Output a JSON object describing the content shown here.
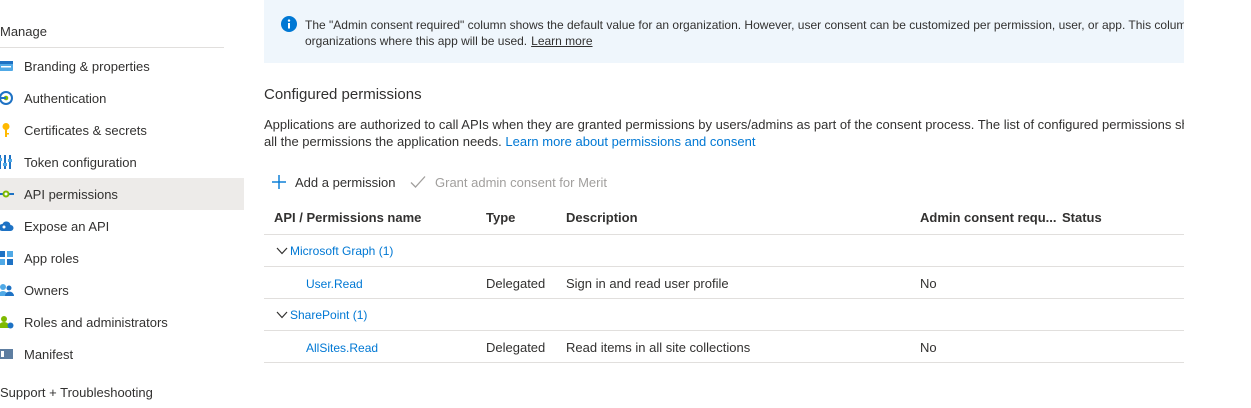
{
  "sidebar": {
    "manage_header": "Manage",
    "support_header": "Support + Troubleshooting",
    "items": [
      {
        "label": "Branding & properties",
        "icon": "branding-icon"
      },
      {
        "label": "Authentication",
        "icon": "authentication-icon"
      },
      {
        "label": "Certificates & secrets",
        "icon": "key-icon"
      },
      {
        "label": "Token configuration",
        "icon": "token-icon"
      },
      {
        "label": "API permissions",
        "icon": "api-permissions-icon",
        "active": true
      },
      {
        "label": "Expose an API",
        "icon": "cloud-icon"
      },
      {
        "label": "App roles",
        "icon": "app-roles-icon"
      },
      {
        "label": "Owners",
        "icon": "owners-icon"
      },
      {
        "label": "Roles and administrators",
        "icon": "roles-admin-icon"
      },
      {
        "label": "Manifest",
        "icon": "manifest-icon"
      }
    ]
  },
  "info_bar": {
    "line1": "The \"Admin consent required\" column shows the default value for an organization. However, user consent can be customized per permission, user, or app. This column may not reflect the value in your organization, or in",
    "line2": "organizations where this app will be used.",
    "learn_more": "Learn more"
  },
  "configured": {
    "title": "Configured permissions",
    "desc_line1": "Applications are authorized to call APIs when they are granted permissions by users/admins as part of the consent process. The list of configured permissions should include",
    "desc_line2": "all the permissions the application needs.",
    "desc_link": "Learn more about permissions and consent"
  },
  "toolbar": {
    "add_label": "Add a permission",
    "grant_label": "Grant admin consent for Merit"
  },
  "table": {
    "headers": {
      "name": "API / Permissions name",
      "type": "Type",
      "description": "Description",
      "admin": "Admin consent requ...",
      "status": "Status"
    },
    "groups": [
      {
        "label": "Microsoft Graph (1)",
        "rows": [
          {
            "name": "User.Read",
            "type": "Delegated",
            "description": "Sign in and read user profile",
            "admin": "No",
            "status": ""
          }
        ]
      },
      {
        "label": "SharePoint (1)",
        "rows": [
          {
            "name": "AllSites.Read",
            "type": "Delegated",
            "description": "Read items in all site collections",
            "admin": "No",
            "status": ""
          }
        ]
      }
    ]
  },
  "colors": {
    "accent": "#0078d4",
    "info_bg": "#eff6fc",
    "active_bg": "#edebe9",
    "disabled": "#a19f9d"
  }
}
